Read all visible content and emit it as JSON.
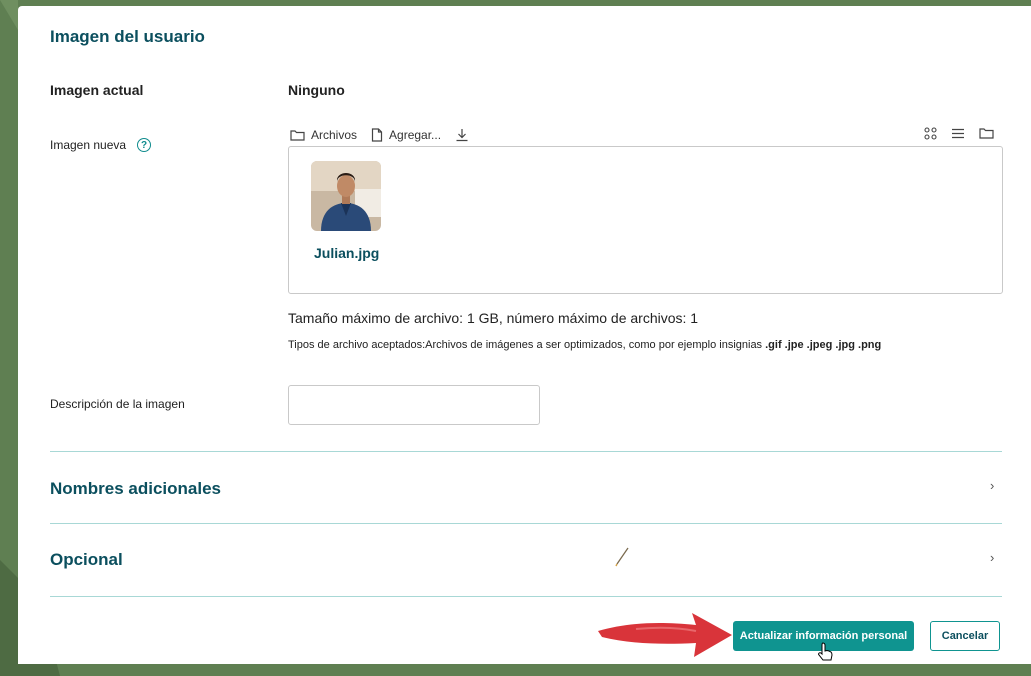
{
  "section": {
    "title": "Imagen del usuario"
  },
  "current_image": {
    "label": "Imagen actual",
    "value": "Ninguno"
  },
  "new_image": {
    "label": "Imagen nueva",
    "help_glyph": "?",
    "toolbar": {
      "files_label": "Archivos",
      "add_label": "Agregar...",
      "icons": [
        "folder-icon",
        "file-icon",
        "download-icon",
        "grid-view-icon",
        "list-view-icon",
        "tree-view-icon"
      ]
    },
    "file": {
      "name": "Julian.jpg"
    },
    "max_size_text": "Tamaño máximo de archivo: 1 GB, número máximo de archivos: 1",
    "accepted_prefix": "Tipos de archivo aceptados:Archivos de imágenes a ser optimizados, como por ejemplo insignias",
    "accepted_types": ".gif .jpe .jpeg .jpg .png"
  },
  "description": {
    "label": "Descripción de la imagen",
    "value": ""
  },
  "accordions": [
    {
      "title": "Nombres adicionales",
      "chevron": "›"
    },
    {
      "title": "Opcional",
      "chevron": "›"
    }
  ],
  "actions": {
    "submit_label": "Actualizar información personal",
    "cancel_label": "Cancelar"
  },
  "colors": {
    "accent": "#0f9490",
    "heading": "#0b4f5e",
    "annotation_arrow": "#d9343a",
    "background": "#5f7f52"
  }
}
